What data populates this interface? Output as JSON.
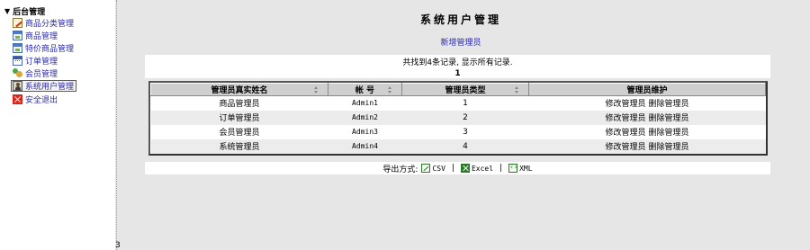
{
  "sidebar": {
    "root_label": "后台管理",
    "root_icon": "triangle-down-icon",
    "items": [
      {
        "label": "商品分类管理",
        "icon": "pencil-icon"
      },
      {
        "label": "商品管理",
        "icon": "window-icon"
      },
      {
        "label": "特价商品管理",
        "icon": "window-icon"
      },
      {
        "label": "订单管理",
        "icon": "calendar-icon"
      },
      {
        "label": "会员管理",
        "icon": "people-icon"
      },
      {
        "label": "系统用户管理",
        "icon": "user-icon",
        "active": true
      },
      {
        "label": "安全退出",
        "icon": "close-icon"
      }
    ]
  },
  "splitter_label": "3",
  "main": {
    "title": "系统用户管理",
    "add_link": "新增管理员",
    "summary": "共找到4条记录, 显示所有记录.",
    "page_number": "1",
    "table": {
      "headers": [
        "管理员真实姓名",
        "帐 号",
        "管理员类型",
        "管理员维护"
      ],
      "rows": [
        {
          "name": "商品管理员",
          "account": "Admin1",
          "type": "1",
          "edit": "修改管理员",
          "delete": "删除管理员"
        },
        {
          "name": "订单管理员",
          "account": "Admin2",
          "type": "2",
          "edit": "修改管理员",
          "delete": "删除管理员"
        },
        {
          "name": "会员管理员",
          "account": "Admin3",
          "type": "3",
          "edit": "修改管理员",
          "delete": "删除管理员"
        },
        {
          "name": "系统管理员",
          "account": "Admin4",
          "type": "4",
          "edit": "修改管理员",
          "delete": "删除管理员"
        }
      ]
    },
    "export": {
      "label": "导出方式:",
      "separator": "|",
      "csv": "CSV",
      "excel": "Excel",
      "xml": "XML"
    }
  },
  "colors": {
    "link": "#2b2ba8",
    "background": "#e6e6e6",
    "header_bg": "#cfcfcf",
    "row_alt": "#ececec"
  }
}
